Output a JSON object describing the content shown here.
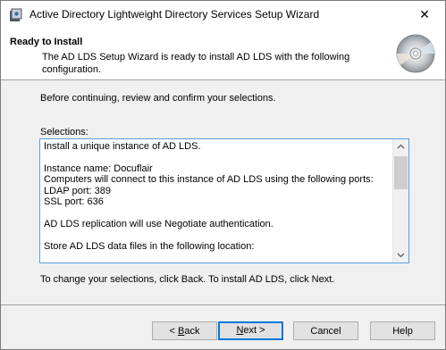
{
  "window": {
    "title": "Active Directory Lightweight Directory Services Setup Wizard"
  },
  "header": {
    "title": "Ready to Install",
    "description": "The AD LDS Setup Wizard is ready to install AD LDS with the following configuration."
  },
  "body": {
    "intro": "Before continuing, review and confirm your selections.",
    "selections_label": "Selections:",
    "selections": [
      "Install a unique instance of AD LDS.",
      "",
      "Instance name: Docuflair",
      "Computers will connect to this instance of AD LDS using the following ports:",
      "LDAP port: 389",
      "SSL port: 636",
      "",
      "AD LDS replication will use Negotiate authentication.",
      "",
      "Store AD LDS data files in the following location:"
    ],
    "footer": "To change your selections, click Back.  To install AD LDS, click Next."
  },
  "buttons": {
    "back": {
      "pre": "< ",
      "accel": "B",
      "post": "ack"
    },
    "next": {
      "accel": "N",
      "post": "ext >"
    },
    "cancel": "Cancel",
    "help": "Help"
  },
  "icons": [
    "app-icon",
    "close-icon",
    "cd-disc-icon",
    "scroll-up-icon",
    "scroll-down-icon"
  ]
}
